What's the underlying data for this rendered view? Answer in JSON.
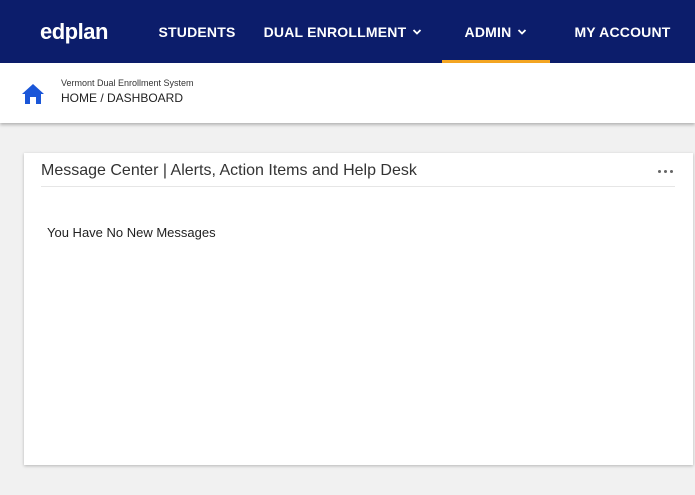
{
  "nav": {
    "logo": "edplan",
    "items": [
      {
        "label": "STUDENTS"
      },
      {
        "label": "DUAL ENROLLMENT"
      },
      {
        "label": "ADMIN"
      },
      {
        "label": "MY ACCOUNT"
      }
    ],
    "active_item": "ADMIN",
    "accent_color": "#f5a623",
    "background_color": "#0c1d6b"
  },
  "breadcrumb": {
    "system_name": "Vermont Dual Enrollment System",
    "path": "HOME / DASHBOARD",
    "icon": "home-icon",
    "icon_color": "#1a56d8"
  },
  "message_center": {
    "title": "Message Center | Alerts, Action Items and Help Desk",
    "menu_icon": "more-horizontal-icon",
    "empty_text": "You Have No New Messages"
  }
}
